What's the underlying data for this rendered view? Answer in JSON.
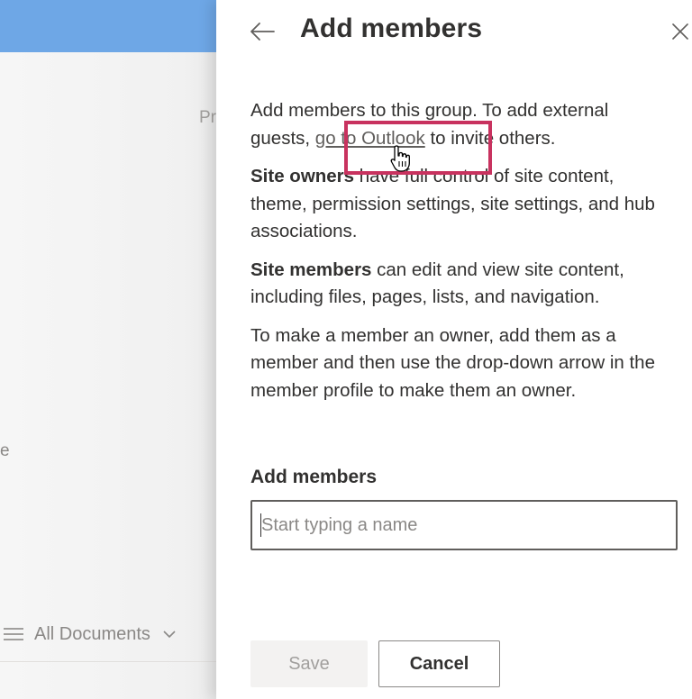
{
  "background": {
    "fragment_top": "Pr",
    "fragment_mid": "e",
    "view": {
      "label": "All Documents",
      "menu_icon": "hamburger-icon",
      "chevron_icon": "chevron-down-icon"
    }
  },
  "panel": {
    "title": "Add members",
    "back_icon": "arrow-left-icon",
    "close_icon": "close-icon",
    "intro": {
      "before_link": "Add members to this group. To add external guests, ",
      "link_text": "go to Outlook",
      "after_link": " to invite others."
    },
    "owners": {
      "bold": "Site owners",
      "text": " have full control of site content, theme, permission settings, site settings, and hub associations."
    },
    "members": {
      "bold": "Site members",
      "text": " can edit and view site content, including files, pages, lists, and navigation."
    },
    "owner_instructions": "To make a member an owner, add them as a member and then use the drop-down arrow in the member profile to make them an owner.",
    "field": {
      "label": "Add members",
      "placeholder": "Start typing a name",
      "value": ""
    },
    "buttons": {
      "save": "Save",
      "cancel": "Cancel"
    }
  },
  "colors": {
    "header_blue": "#6ea7e6",
    "highlight": "#c8325f",
    "text": "#323130",
    "muted": "#a19f9d"
  }
}
